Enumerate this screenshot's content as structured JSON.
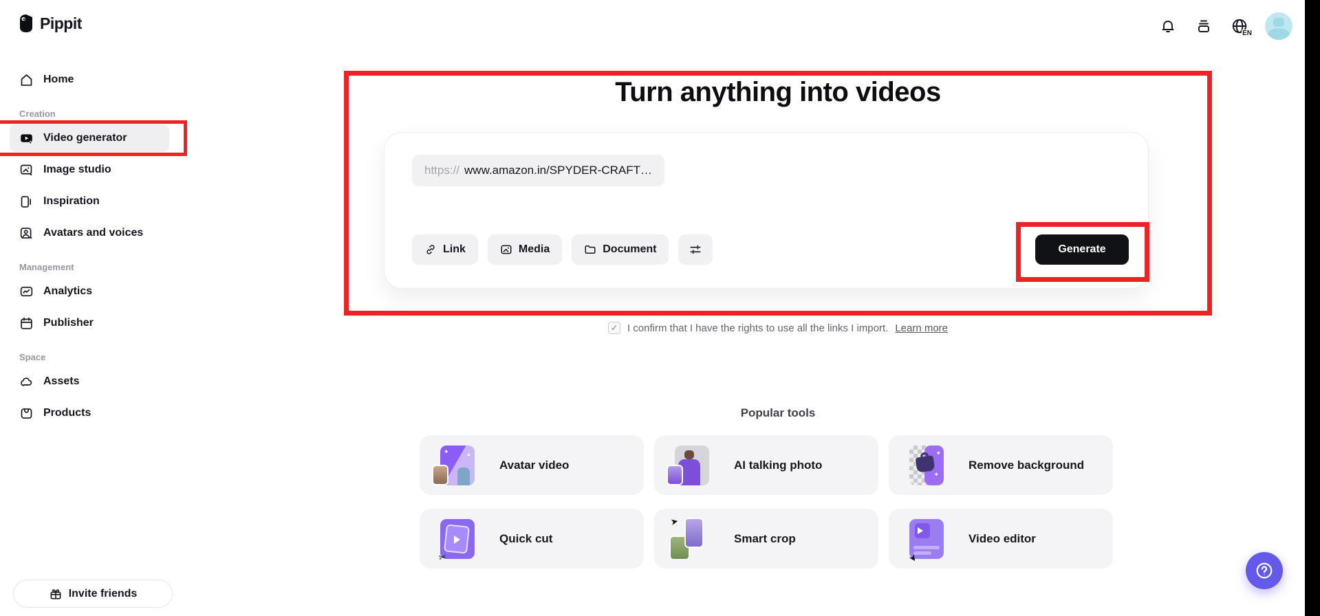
{
  "brand": {
    "name": "Pippit"
  },
  "header": {
    "icons": [
      "notifications",
      "workspace",
      "language",
      "account"
    ],
    "language": "EN"
  },
  "sidebar": {
    "home": {
      "label": "Home"
    },
    "sections": [
      {
        "title": "Creation",
        "items": [
          {
            "label": "Video generator",
            "active": true,
            "annotated": true
          },
          {
            "label": "Image studio"
          },
          {
            "label": "Inspiration"
          },
          {
            "label": "Avatars and voices"
          }
        ]
      },
      {
        "title": "Management",
        "items": [
          {
            "label": "Analytics"
          },
          {
            "label": "Publisher"
          }
        ]
      },
      {
        "title": "Space",
        "items": [
          {
            "label": "Assets"
          },
          {
            "label": "Products"
          }
        ]
      }
    ],
    "invite_label": "Invite friends"
  },
  "main": {
    "title": "Turn anything into videos",
    "input": {
      "url_prefix": "https://",
      "url_value": "www.amazon.in/SPYDER-CRAFT…"
    },
    "toolbar": {
      "link_label": "Link",
      "media_label": "Media",
      "document_label": "Document",
      "settings_icon": "sliders",
      "generate_label": "Generate"
    },
    "consent": {
      "checked": true,
      "text": "I confirm that I have the rights to use all the links I import.",
      "link_label": "Learn more"
    }
  },
  "popular_tools": {
    "title": "Popular tools",
    "items": [
      {
        "label": "Avatar video"
      },
      {
        "label": "AI talking photo"
      },
      {
        "label": "Remove background"
      },
      {
        "label": "Quick cut"
      },
      {
        "label": "Smart crop"
      },
      {
        "label": "Video editor"
      }
    ]
  },
  "colors": {
    "annotation_red": "#ec2227",
    "accent_purple": "#6459ea",
    "thumb_purple": "#8b5cf6",
    "avatar_teal": "#bfe7f0",
    "button_black": "#111215"
  }
}
